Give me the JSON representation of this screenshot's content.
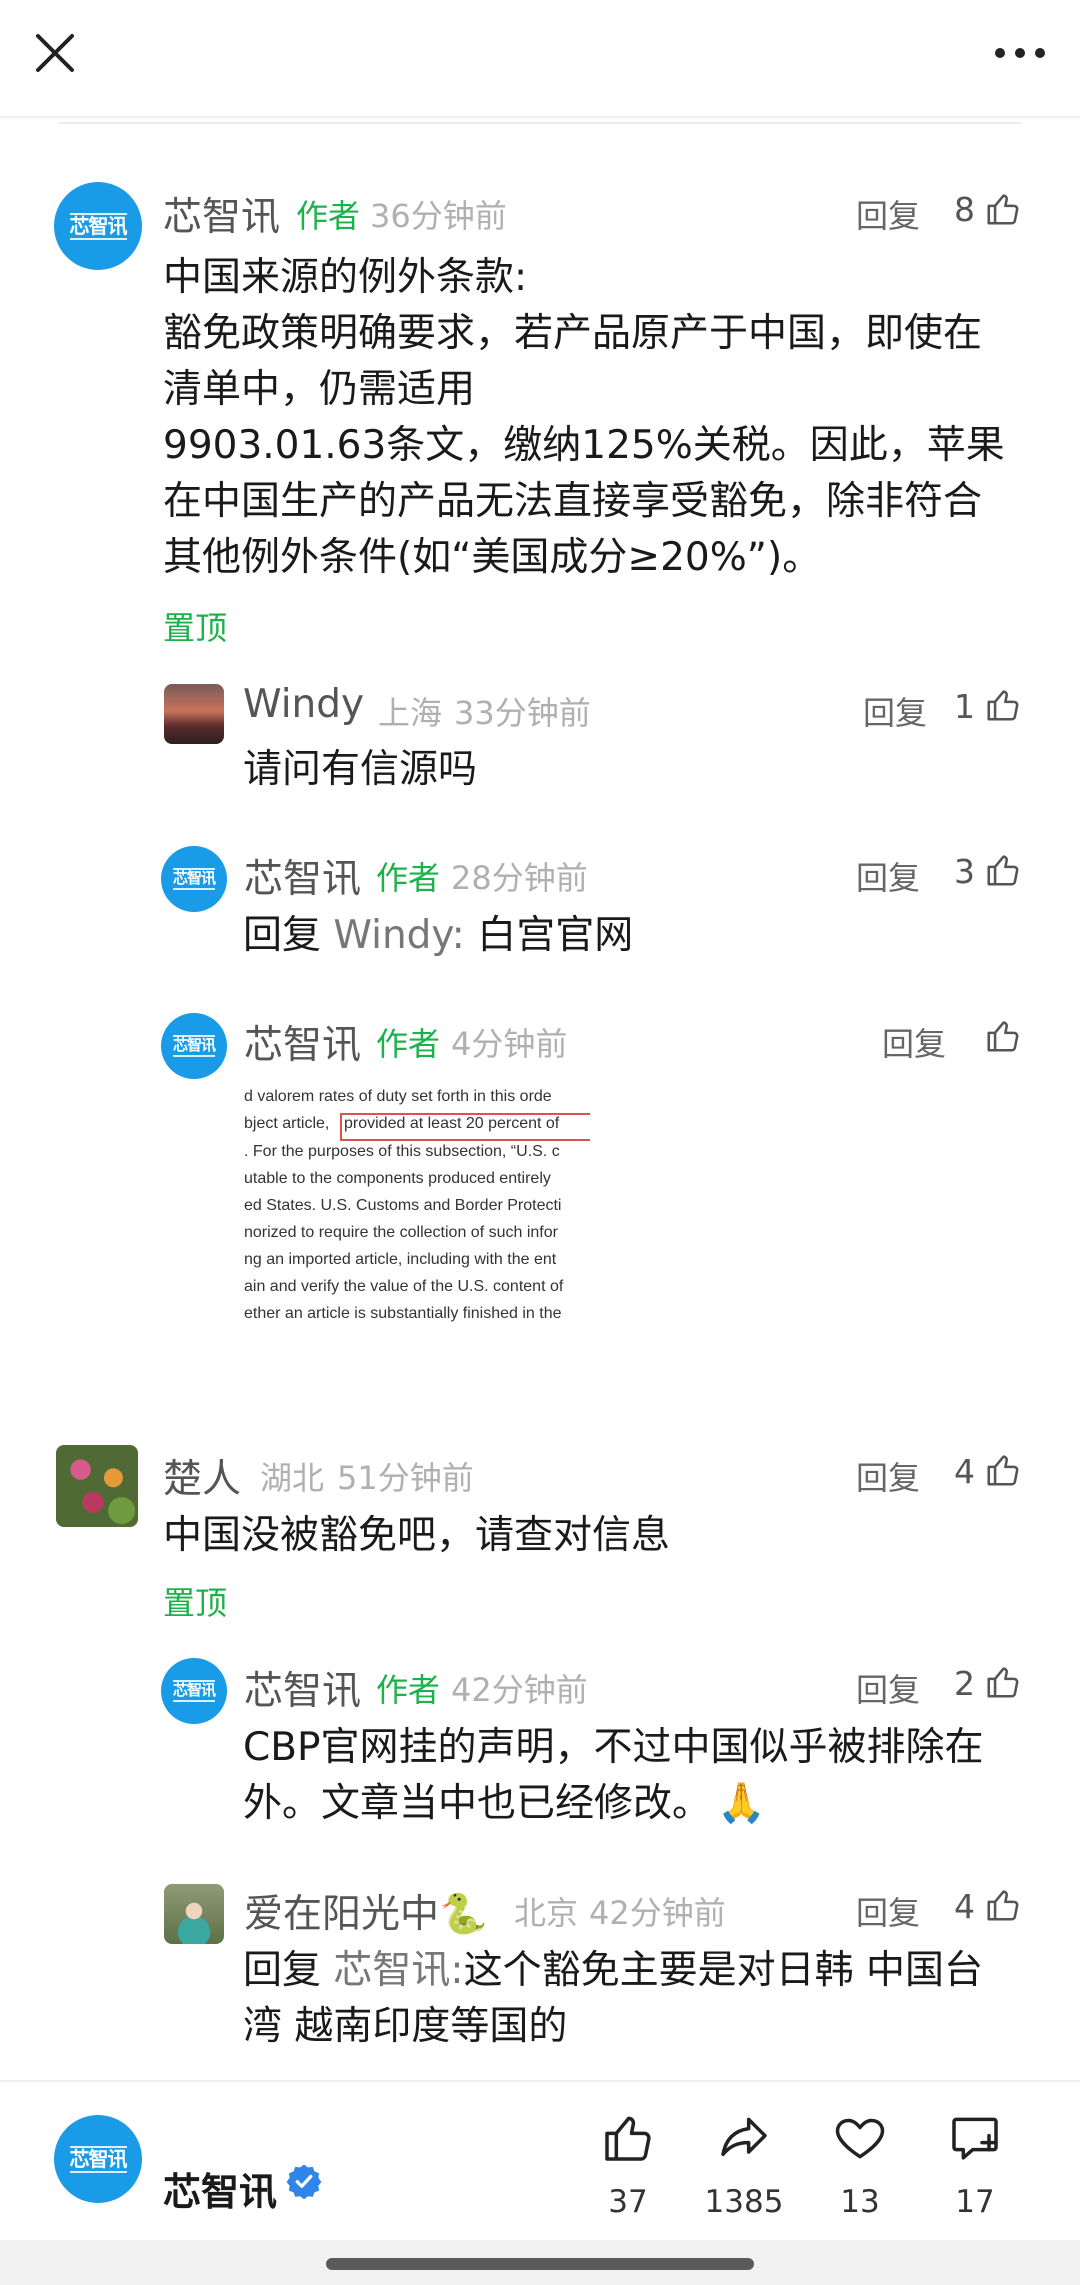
{
  "comments": [
    {
      "name": "芯智讯",
      "author_tag": "作者",
      "time": "36分钟前",
      "reply": "回复",
      "likes": "8",
      "body": [
        "中国来源的例外条款:",
        "豁免政策明确要求，若产品原产于中国，即使在",
        "清单中，仍需适用",
        "9903.01.63条文，缴纳125%关税。因此，苹果",
        "在中国生产的产品无法直接享受豁免，除非符合",
        "其他例外条件(如“美国成分≥20%”)。"
      ],
      "pin": "置顶",
      "replies": [
        {
          "name": "Windy",
          "location": "上海",
          "time": "33分钟前",
          "reply": "回复",
          "likes": "1",
          "body": "请问有信源吗"
        },
        {
          "name": "芯智讯",
          "author_tag": "作者",
          "time": "28分钟前",
          "reply": "回复",
          "likes": "3",
          "reply_prefix": "回复",
          "reply_to": "Windy:",
          "body": "白宫官网"
        },
        {
          "name": "芯智讯",
          "author_tag": "作者",
          "time": "4分钟前",
          "reply": "回复",
          "image_lines": [
            "d valorem rates of duty set forth in this orde",
            "bject article,",
            "provided at least 20 percent of",
            ". For the purposes of this subsection, “U.S. c",
            "utable to the components produced entirely",
            "ed States.  U.S. Customs and Border Protecti",
            "norized to require the collection of such infor",
            "ng an imported article, including with the ent",
            "ain and verify the value of the U.S. content of",
            "ether an article is substantially finished in the"
          ]
        }
      ]
    },
    {
      "name": "楚人",
      "location": "湖北",
      "time": "51分钟前",
      "reply": "回复",
      "likes": "4",
      "body": "中国没被豁免吧，请查对信息",
      "pin": "置顶",
      "replies": [
        {
          "name": "芯智讯",
          "author_tag": "作者",
          "time": "42分钟前",
          "reply": "回复",
          "likes": "2",
          "body": [
            "CBP官网挂的声明，不过中国似乎被排除在",
            "外。文章当中也已经修改。"
          ],
          "emoji": "🙏"
        },
        {
          "name": "爱在阳光中",
          "name_emoji": "🐍",
          "location": "北京",
          "time": "42分钟前",
          "reply": "回复",
          "likes": "4",
          "reply_prefix": "回复",
          "reply_to": "芯智讯:",
          "body": [
            "这个豁免主要是对日韩 中国台",
            "湾 越南印度等国的"
          ]
        }
      ]
    }
  ],
  "bottom_bar": {
    "name": "芯智讯",
    "likes": "37",
    "shares": "1385",
    "favorites": "13",
    "comments": "17"
  },
  "avatar_text": "芯智讯",
  "colors": {
    "brand_blue": "#1a9be8",
    "author_green": "#1cb24b",
    "meta_gray": "#b0b0b0",
    "verified_blue": "#2f86e8"
  },
  "icons": [
    "close-icon",
    "more-icon",
    "thumb-up-icon",
    "share-icon",
    "heart-icon",
    "comment-add-icon",
    "verified-icon",
    "pray-emoji",
    "snake-emoji"
  ]
}
